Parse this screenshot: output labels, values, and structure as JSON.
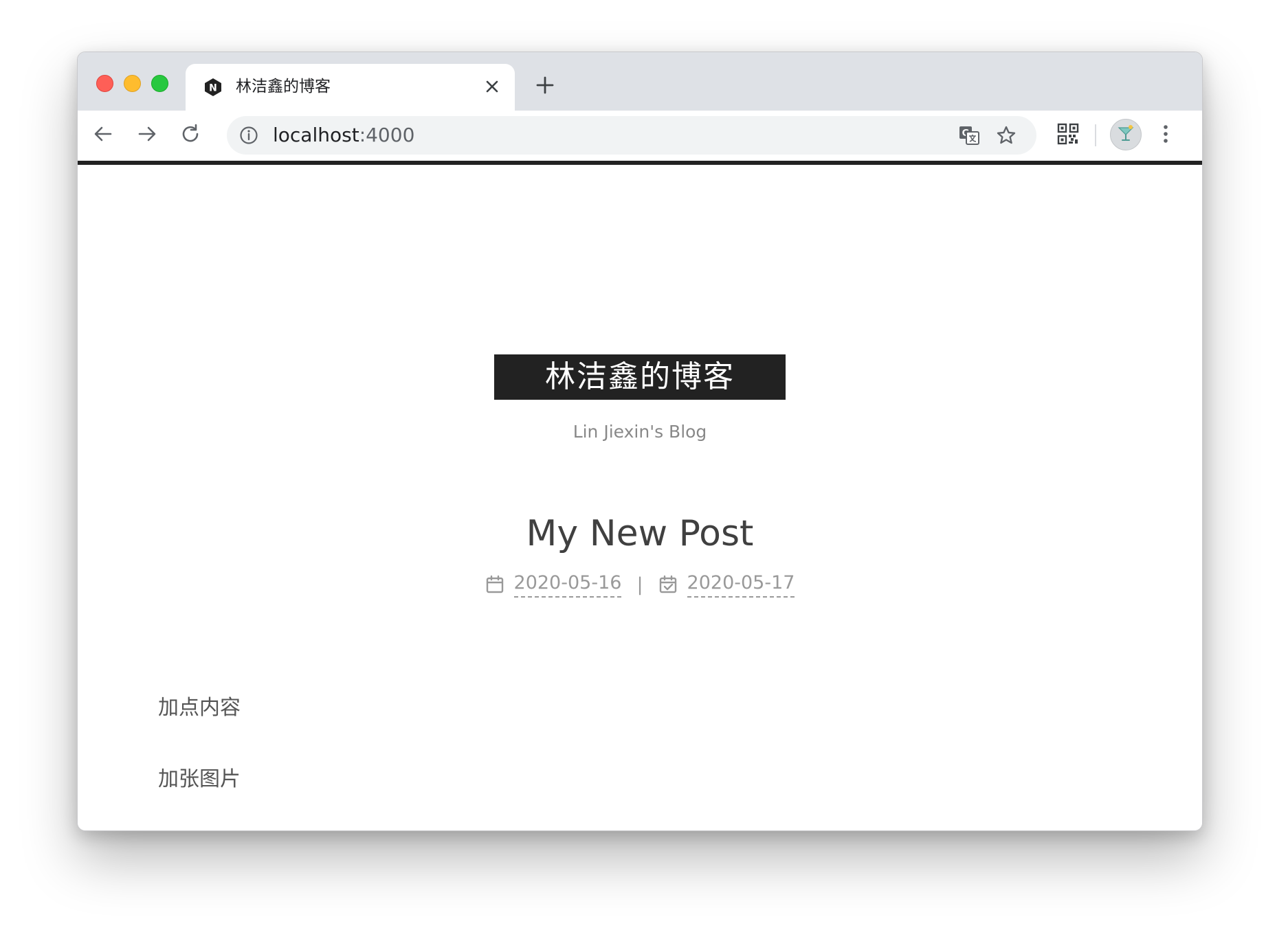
{
  "browser": {
    "tab": {
      "title": "林洁鑫的博客",
      "favicon": "next-theme-favicon-icon"
    },
    "new_tab_icon": "plus-icon",
    "address_bar": {
      "host": "localhost",
      "port": ":4000"
    },
    "icons": {
      "back": "arrow-left-icon",
      "forward": "arrow-right-icon",
      "reload": "reload-icon",
      "info": "info-icon",
      "translate": "translate-icon",
      "bookmark": "star-icon",
      "qr": "qr-code-icon",
      "profile": "avatar",
      "menu": "more-vertical-icon"
    }
  },
  "site": {
    "title": "林洁鑫的博客",
    "subtitle": "Lin Jiexin's Blog"
  },
  "post": {
    "title": "My New Post",
    "created": "2020-05-16",
    "updated": "2020-05-17",
    "divider": "|",
    "paragraphs": [
      "加点内容",
      "加张图片"
    ]
  },
  "colors": {
    "brand_bg": "#222222",
    "tab_strip": "#dee1e6",
    "omnibox": "#f1f3f4"
  }
}
